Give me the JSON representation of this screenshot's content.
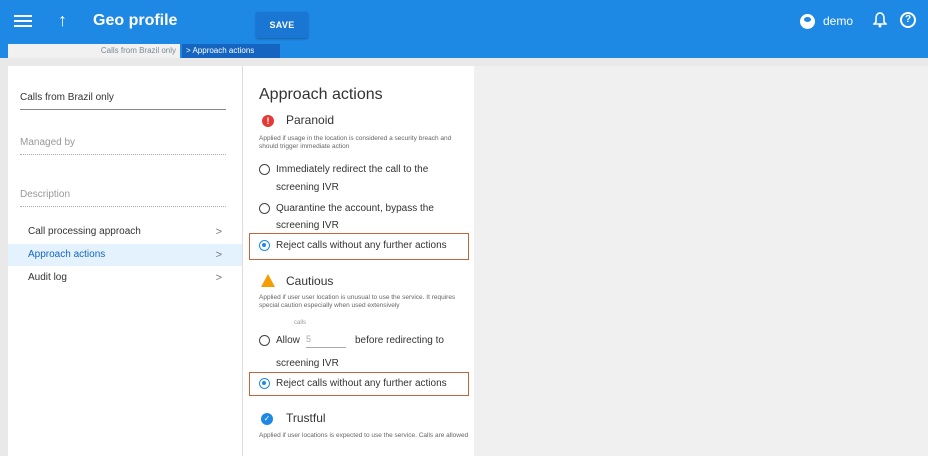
{
  "header": {
    "title": "Geo profile",
    "save_label": "SAVE",
    "username": "demo",
    "help_glyph": "?"
  },
  "breadcrumb": {
    "parent": "Calls from Brazil only",
    "separator": ">",
    "current": "Approach actions"
  },
  "left": {
    "name_value": "Calls from Brazil only",
    "managed_by_placeholder": "Managed by",
    "description_placeholder": "Description",
    "nav": [
      {
        "label": "Call processing approach",
        "chev": ">"
      },
      {
        "label": "Approach actions",
        "chev": ">"
      },
      {
        "label": "Audit log",
        "chev": ">"
      }
    ]
  },
  "main": {
    "title": "Approach actions",
    "paranoid": {
      "title": "Paranoid",
      "desc": "Applied if usage in the location is considered a security breach and should trigger immediate action",
      "opt1": "Immediately redirect the call to the",
      "opt1b": "screening IVR",
      "opt2": "Quarantine the account, bypass the",
      "opt2b": "screening IVR",
      "opt3": "Reject calls without any further actions"
    },
    "cautious": {
      "title": "Cautious",
      "desc": "Applied if user user location is unusual to use the service. It requires special caution especially when used extensively",
      "calls_label": "calls",
      "allow_label": "Allow",
      "allow_value": "5",
      "before_label": "before redirecting to",
      "screening": "screening IVR",
      "reject": "Reject calls without any further actions"
    },
    "trustful": {
      "title": "Trustful",
      "desc": "Applied if user locations is expected to use the service. Calls are allowed"
    }
  },
  "colors": {
    "accent": "#1e88e5",
    "highlight_border": "#c9643a",
    "danger": "#e53935",
    "warning": "#f59c00"
  }
}
